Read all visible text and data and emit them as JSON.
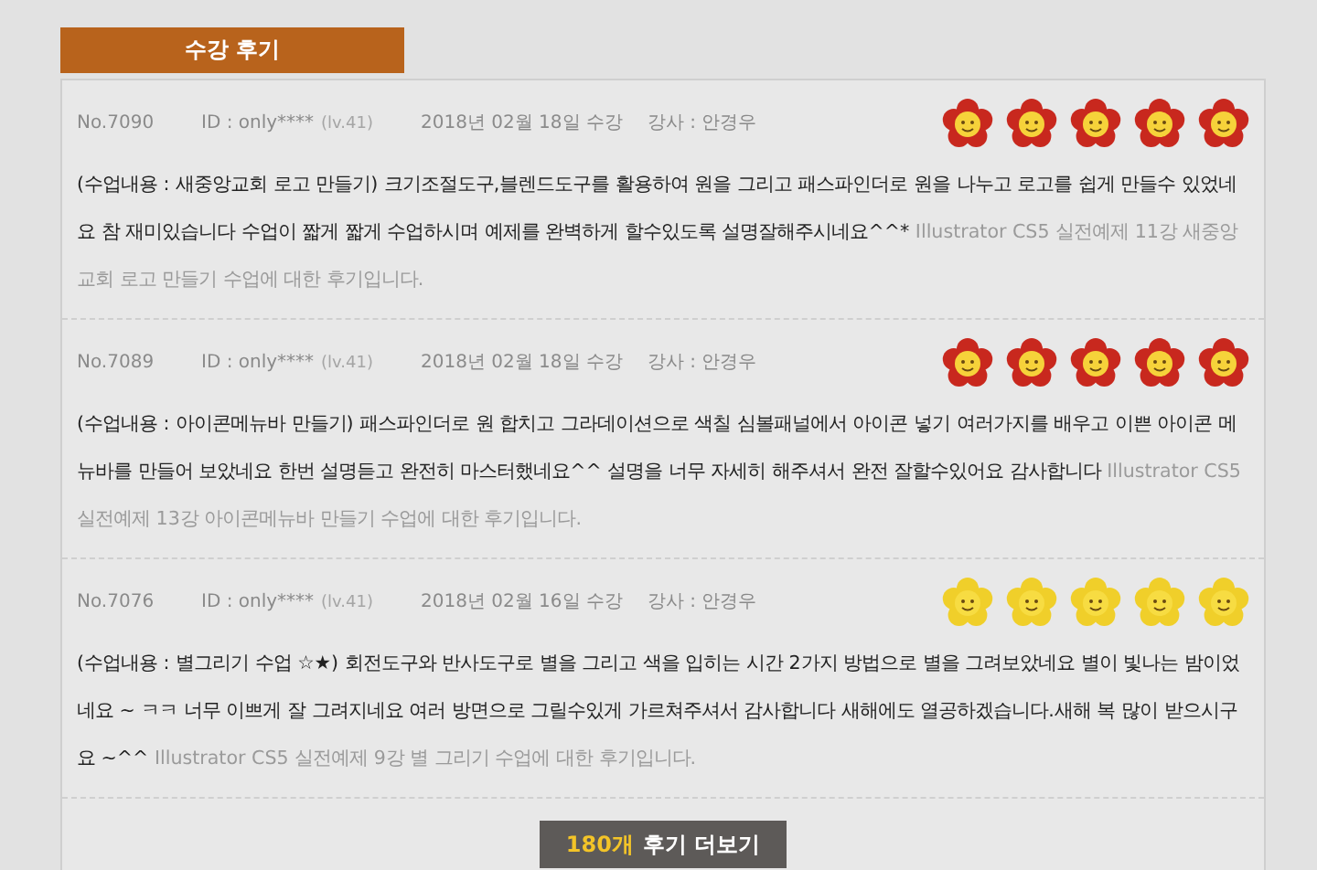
{
  "section_tab": {
    "label": "수강 후기"
  },
  "reviews": [
    {
      "number": "No.7090",
      "user_id": "ID : only****",
      "level": "(lv.41)",
      "date": "2018년 02월 18일 수강",
      "instructor": "강사 : 안경우",
      "kind": "red-flower",
      "stars": 5,
      "review": "(수업내용 : 새중앙교회 로고 만들기) 크기조절도구,블렌드도구를 활용하여 원을 그리고 패스파인더로 원을 나누고 로고를 쉽게 만들수 있었네요 참 재미있습니다 수업이 짧게 짧게 수업하시며 예제를 완벽하게 할수있도록 설명잘해주시네요^^*",
      "note": "Illustrator CS5 실전예제 11강 새중앙교회 로고 만들기 수업에 대한 후기입니다."
    },
    {
      "number": "No.7089",
      "user_id": "ID : only****",
      "level": "(lv.41)",
      "date": "2018년 02월 18일 수강",
      "instructor": "강사 : 안경우",
      "kind": "red-flower",
      "stars": 5,
      "review": "(수업내용 : 아이콘메뉴바 만들기) 패스파인더로 원 합치고 그라데이션으로 색칠 심볼패널에서 아이콘 넣기 여러가지를 배우고 이쁜 아이콘 메뉴바를 만들어 보았네요 한번 설명듣고 완전히 마스터했네요^^ 설명을 너무 자세히 해주셔서 완전 잘할수있어요 감사합니다",
      "note": "Illustrator CS5 실전예제 13강 아이콘메뉴바 만들기 수업에 대한 후기입니다."
    },
    {
      "number": "No.7076",
      "user_id": "ID : only****",
      "level": "(lv.41)",
      "date": "2018년 02월 16일 수강",
      "instructor": "강사 : 안경우",
      "kind": "yellow-flower",
      "stars": 5,
      "review": "(수업내용 : 별그리기 수업 ☆★) 회전도구와 반사도구로 별을 그리고 색을 입히는 시간 2가지 방법으로 별을 그려보았네요 별이 빛나는 밤이었네요 ~ ㅋㅋ 너무 이쁘게 잘 그려지네요 여러 방면으로 그릴수있게 가르쳐주셔서 감사합니다 새해에도 열공하겠습니다.새해 복 많이 받으시구요 ~^^",
      "note": "Illustrator CS5 실전예제 9강 별 그리기 수업에 대한 후기입니다."
    }
  ],
  "more_button": {
    "count": "180개",
    "label": "후기 더보기"
  }
}
